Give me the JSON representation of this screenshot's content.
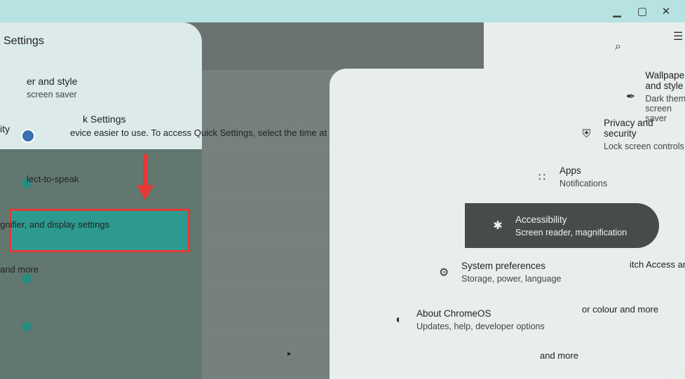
{
  "window": {
    "minimize_icon": "minimize-icon",
    "maximize_icon": "maximize-icon",
    "close_icon": "close-icon"
  },
  "header": {
    "title": "Settings",
    "search_icon": "search-icon",
    "menu_icon": "hamburger-icon"
  },
  "left": {
    "wallpaper_title": "er and style",
    "wallpaper_sub": "screen saver",
    "quick_settings_title": "k Settings",
    "section_label": "ity",
    "quick_settings_desc": "evice easier to use. To access Quick Settings, select the time at the bottom of your screen",
    "select_to_speak": "lect-to-speak",
    "magnifier": "gnifier, and display settings",
    "and_more": "and more"
  },
  "menu": {
    "items": [
      {
        "title": "Wallpaper and style",
        "subtitle": "Dark theme, screen saver",
        "icon": "paintbrush-icon"
      },
      {
        "title": "Privacy and security",
        "subtitle": "Lock screen controls",
        "icon": "shield-icon"
      },
      {
        "title": "Apps",
        "subtitle": "Notifications",
        "icon": "apps-grid-icon"
      },
      {
        "title": "Accessibility",
        "subtitle": "Screen reader, magnification",
        "icon": "accessibility-icon"
      },
      {
        "title": "System preferences",
        "subtitle": "Storage, power, language",
        "icon": "gear-icon"
      },
      {
        "title": "About ChromeOS",
        "subtitle": "Updates, help, developer options",
        "icon": "chromeos-icon"
      }
    ]
  },
  "right_fragments": {
    "switch_access": "itch Access and",
    "colour": "or colour and more",
    "and_more": "and more"
  },
  "colors": {
    "highlight_border": "#e53935",
    "arrow": "#e53935",
    "selected_item": "#474c4b"
  }
}
